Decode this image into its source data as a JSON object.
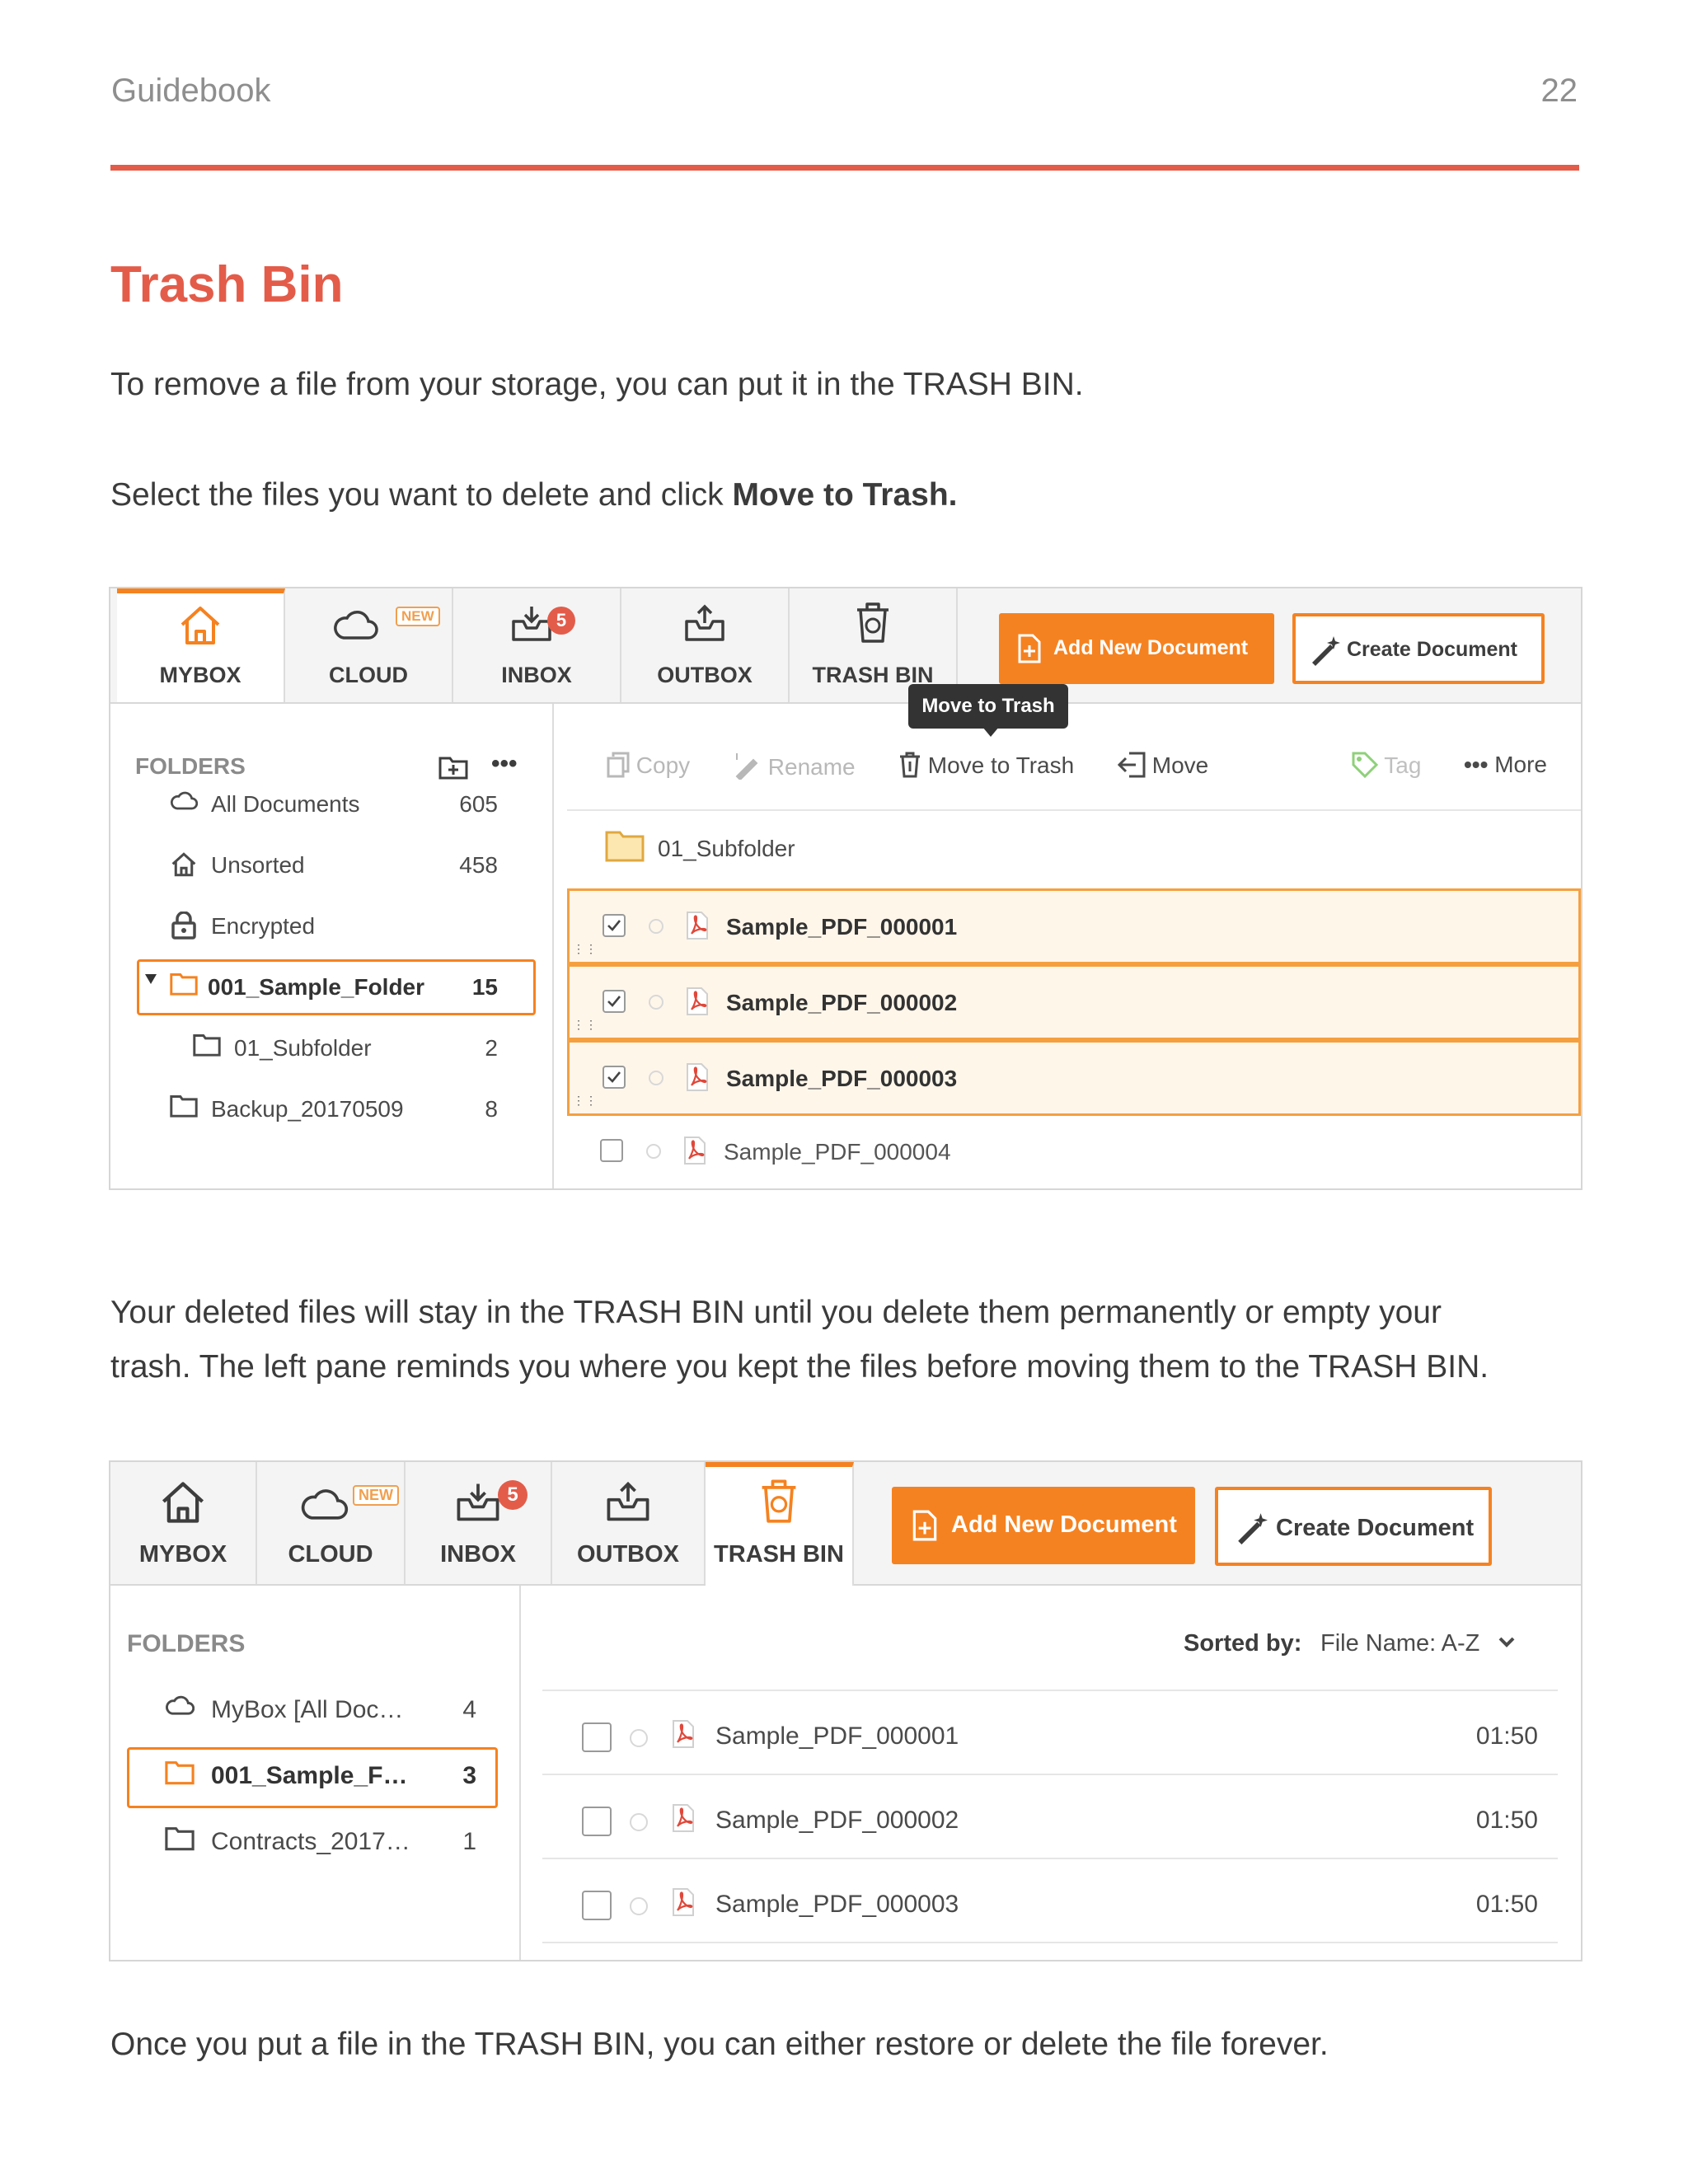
{
  "page": {
    "header_left": "Guidebook",
    "page_number": "22",
    "title": "Trash Bin",
    "para1": "To remove a file from your storage, you can put it in the TRASH BIN.",
    "para2_prefix": "Select the files you want to delete and click ",
    "para2_bold": "Move to Trash.",
    "para3_line1": "Your deleted files will stay in the TRASH BIN until you delete them permanently or empty your",
    "para3_line2": "trash. The left pane reminds you where you kept the files before moving them to the TRASH BIN.",
    "para4": "Once you put a file in the TRASH BIN, you can either restore or delete the file forever.",
    "accent_color": "#e35c4a",
    "orange": "#f58220"
  },
  "shot1": {
    "tabs": {
      "mybox": "MYBOX",
      "cloud": "CLOUD",
      "inbox": "INBOX",
      "outbox": "OUTBOX",
      "trash": "TRASH BIN"
    },
    "new_tag": "NEW",
    "inbox_badge": "5",
    "add_button": "Add New Document",
    "create_button": "Create Document",
    "tooltip": "Move to Trash",
    "folders_title": "FOLDERS",
    "more_dots": "•••",
    "folders": [
      {
        "name": "All Documents",
        "count": "605",
        "icon": "cloud-icon"
      },
      {
        "name": "Unsorted",
        "count": "458",
        "icon": "home-icon"
      },
      {
        "name": "Encrypted",
        "count": "",
        "icon": "lock-icon"
      },
      {
        "name": "001_Sample_Folder",
        "count": "15",
        "icon": "folder-icon"
      },
      {
        "name": "01_Subfolder",
        "count": "2",
        "icon": "folder-icon"
      },
      {
        "name": "Backup_20170509",
        "count": "8",
        "icon": "folder-icon"
      }
    ],
    "toolbar": {
      "copy": "Copy",
      "rename": "Rename",
      "move_to_trash": "Move to Trash",
      "move": "Move",
      "tag": "Tag",
      "more": "More",
      "more_dots": "•••"
    },
    "subfolder_row": "01_Subfolder",
    "files": [
      {
        "name": "Sample_PDF_000001",
        "checked": true
      },
      {
        "name": "Sample_PDF_000002",
        "checked": true
      },
      {
        "name": "Sample_PDF_000003",
        "checked": true
      },
      {
        "name": "Sample_PDF_000004",
        "checked": false
      }
    ]
  },
  "shot2": {
    "tabs": {
      "mybox": "MYBOX",
      "cloud": "CLOUD",
      "inbox": "INBOX",
      "outbox": "OUTBOX",
      "trash": "TRASH BIN"
    },
    "new_tag": "NEW",
    "inbox_badge": "5",
    "add_button": "Add New Document",
    "create_button": "Create Document",
    "folders_title": "FOLDERS",
    "folders": [
      {
        "name": "MyBox [All Doc…",
        "count": "4",
        "icon": "cloud-icon"
      },
      {
        "name": "001_Sample_F…",
        "count": "3",
        "icon": "folder-icon"
      },
      {
        "name": "Contracts_2017…",
        "count": "1",
        "icon": "folder-icon"
      }
    ],
    "sorted_by_label": "Sorted by:",
    "sorted_by_value": "File Name: A-Z",
    "files": [
      {
        "name": "Sample_PDF_000001",
        "time": "01:50"
      },
      {
        "name": "Sample_PDF_000002",
        "time": "01:50"
      },
      {
        "name": "Sample_PDF_000003",
        "time": "01:50"
      }
    ]
  }
}
